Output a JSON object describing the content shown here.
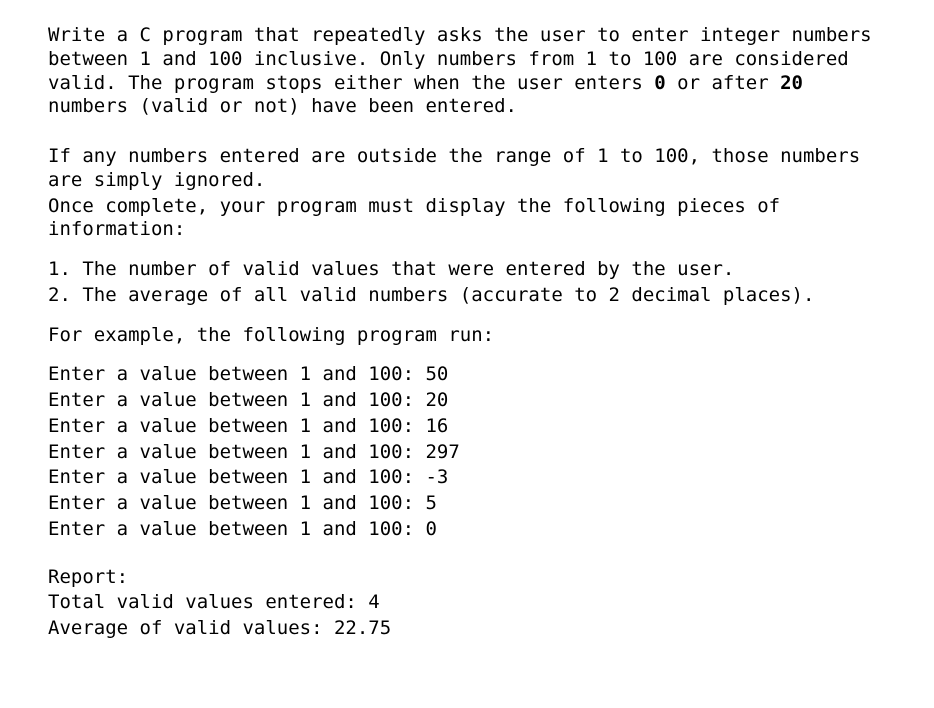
{
  "intro": {
    "p1_a": "Write a C program that repeatedly asks the user to enter integer numbers between 1 and 100 inclusive. Only numbers from 1 to 100 are considered valid. The program stops either when the user enters ",
    "p1_bold1": "0",
    "p1_b": " or after ",
    "p1_bold2": "20",
    "p1_c": " numbers (valid or not) have been entered."
  },
  "middle": {
    "l1": "If any numbers entered are outside the range of 1 to 100, those numbers are simply ignored.",
    "l2": "Once complete, your program must display the following pieces of information:"
  },
  "requirements": [
    "1. The number of valid values that were entered by the user.",
    "2. The average of all valid numbers (accurate to 2 decimal places)."
  ],
  "example_lead": "For example, the following program run:",
  "prompts": [
    "Enter a value between 1 and 100: 50",
    "Enter a value between 1 and 100: 20",
    "Enter a value between 1 and 100: 16",
    "Enter a value between 1 and 100: 297",
    "Enter a value between 1 and 100: -3",
    "Enter a value between 1 and 100: 5",
    "Enter a value between 1 and 100: 0"
  ],
  "report": {
    "header": "Report:",
    "total": "Total valid values entered: 4",
    "average": "Average of valid values: 22.75"
  }
}
